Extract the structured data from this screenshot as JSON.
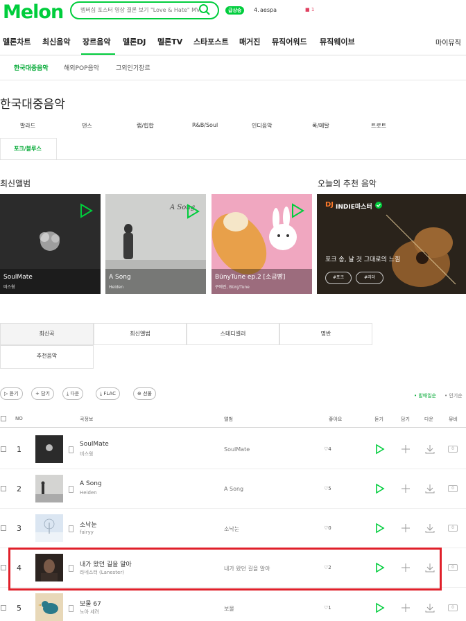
{
  "header": {
    "logo": "Melon",
    "search_text": "멤버십 포스터 영상 결론 보기 \"Love & Hate\" MV",
    "rank_badge": "급상승",
    "rank_num": "4.",
    "rank_text": "aespa",
    "rank_change": "■ 1"
  },
  "gnb": [
    "멜론차트",
    "최신음악",
    "장르음악",
    "멜론DJ",
    "멜론TV",
    "스타포스트",
    "매거진",
    "뮤직어워드",
    "뮤직웨이브",
    "마이뮤직"
  ],
  "subnav": [
    "한국대중음악",
    "해외POP음악",
    "그외인기장르"
  ],
  "page_title": "한국대중음악",
  "genres": [
    "발라드",
    "댄스",
    "랩/힙합",
    "R&B/Soul",
    "인디음악",
    "록/메탈",
    "트로트",
    "포크/블루스"
  ],
  "sections": {
    "new_albums": "최신앨범",
    "recommend": "오늘의 추천 음악"
  },
  "albums": [
    {
      "title": "SoulMate",
      "artist": "비스윗"
    },
    {
      "title": "A Song",
      "artist": "Heiden"
    },
    {
      "title": "BünyTune ep.2 [소금빵]",
      "artist": "쿠에린, Bünj/Tune"
    }
  ],
  "dj": {
    "prefix": "DJ",
    "name": "INDIE마스터",
    "title": "포크 송, 날 것 그대로의 느낌",
    "tags": [
      "#포크",
      "#리더"
    ]
  },
  "tabs": [
    "최신곡",
    "최신앨범",
    "스테디셀러",
    "명반",
    "추천음악"
  ],
  "actions": [
    "듣기",
    "+ 담기",
    "다운",
    "FLAC",
    "선물"
  ],
  "sort": {
    "active": "• 발매일순",
    "other": "• 인기순"
  },
  "columns": {
    "no": "NO",
    "song": "곡정보",
    "album": "앨범",
    "like": "좋아요",
    "play": "듣기",
    "add": "담기",
    "down": "다운",
    "mv": "뮤비"
  },
  "songs": [
    {
      "rank": "1",
      "title": "SoulMate",
      "artist": "비스윗",
      "album": "SoulMate",
      "likes": "4"
    },
    {
      "rank": "2",
      "title": "A Song",
      "artist": "Heiden",
      "album": "A Song",
      "likes": "5"
    },
    {
      "rank": "3",
      "title": "소낙눈",
      "artist": "fairyy",
      "album": "소낙눈",
      "likes": "0"
    },
    {
      "rank": "4",
      "title": "내가 왔던 길을 알아",
      "artist": "라네스터 (Lanester)",
      "album": "내가 왔던 길을 알아",
      "likes": "2"
    },
    {
      "rank": "5",
      "title": "보물 67",
      "artist": "노아 세려",
      "album": "보물",
      "likes": "1"
    }
  ],
  "mv_label": "0",
  "colors": {
    "brand": "#00cd3c",
    "highlight": "#e0202a"
  }
}
